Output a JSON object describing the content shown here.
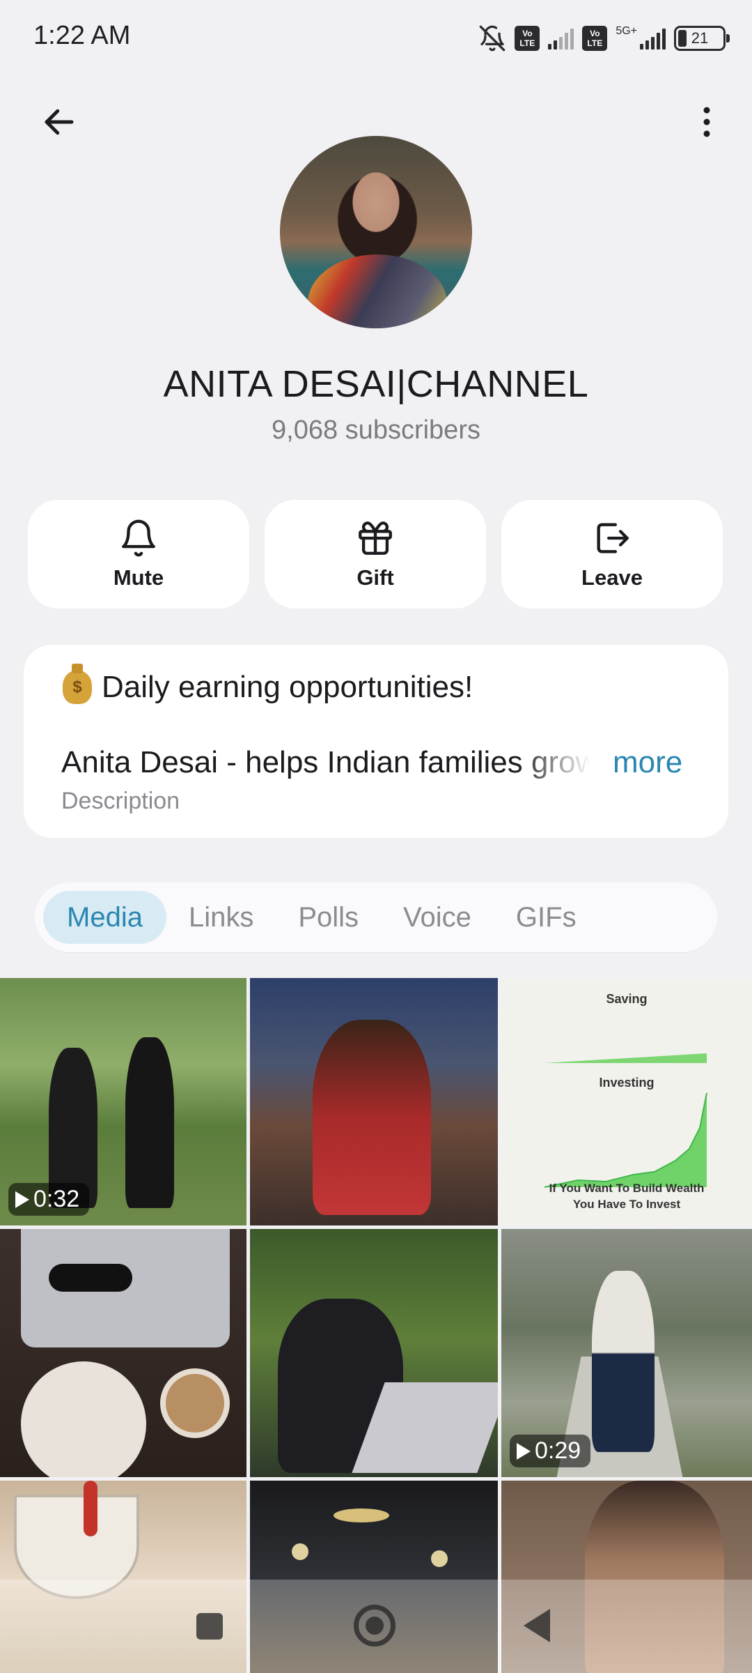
{
  "status_bar": {
    "time": "1:22 AM",
    "volte1": "Vo LTE",
    "volte2": "Vo LTE",
    "network": "5G+",
    "battery": "21"
  },
  "header": {
    "back_icon": "arrow-left-icon",
    "menu_icon": "more-vertical-icon"
  },
  "channel": {
    "name": "ANITA DESAI|CHANNEL",
    "subscribers": "9,068 subscribers"
  },
  "actions": [
    {
      "label": "Mute",
      "icon": "bell-icon"
    },
    {
      "label": "Gift",
      "icon": "gift-icon"
    },
    {
      "label": "Leave",
      "icon": "leave-icon"
    }
  ],
  "info": {
    "promo_text": "Daily earning opportunities!",
    "description": "Anita Desai - helps Indian families grow their wealth",
    "more_label": "more",
    "description_label": "Description"
  },
  "tabs": [
    {
      "label": "Media",
      "active": true
    },
    {
      "label": "Links",
      "active": false
    },
    {
      "label": "Polls",
      "active": false
    },
    {
      "label": "Voice",
      "active": false
    },
    {
      "label": "GIFs",
      "active": false
    }
  ],
  "media": {
    "video1_duration": "0:32",
    "video2_duration": "0:29",
    "chart_thumb": {
      "label_top": "Saving",
      "label_mid": "Investing",
      "caption_line1": "If You Want To Build Wealth",
      "caption_line2": "You Have To Invest"
    }
  },
  "colors": {
    "accent": "#2a86b0",
    "tab_active_bg": "#d8ebf4",
    "background": "#f1f1f4"
  }
}
